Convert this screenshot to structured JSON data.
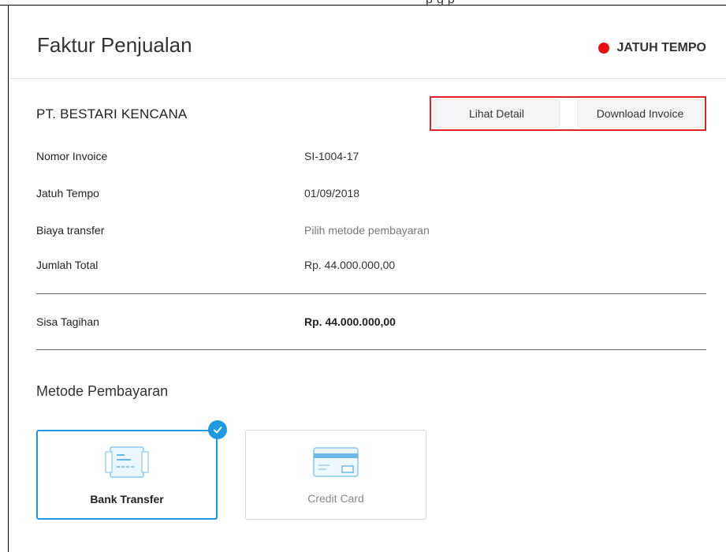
{
  "top_fragment": "p        g        p",
  "header": {
    "title": "Faktur Penjualan",
    "status_label": "JATUH TEMPO",
    "status_color": "#e81010"
  },
  "company": "PT. BESTARI KENCANA",
  "actions": {
    "detail_label": "Lihat Detail",
    "download_label": "Download Invoice"
  },
  "details": [
    {
      "label": "Nomor Invoice",
      "value": "SI-1004-17"
    },
    {
      "label": "Jatuh Tempo",
      "value": "01/09/2018"
    },
    {
      "label": "Biaya transfer",
      "value": "Pilih metode pembayaran"
    },
    {
      "label": "Jumlah Total",
      "value": "Rp. 44.000.000,00"
    }
  ],
  "balance": {
    "label": "Sisa Tagihan",
    "value": "Rp. 44.000.000,00"
  },
  "payment": {
    "title": "Metode Pembayaran",
    "methods": [
      {
        "label": "Bank Transfer",
        "icon": "bank-transfer-icon",
        "selected": true
      },
      {
        "label": "Credit Card",
        "icon": "credit-card-icon",
        "selected": false
      }
    ],
    "accent_color": "#2196dd"
  }
}
